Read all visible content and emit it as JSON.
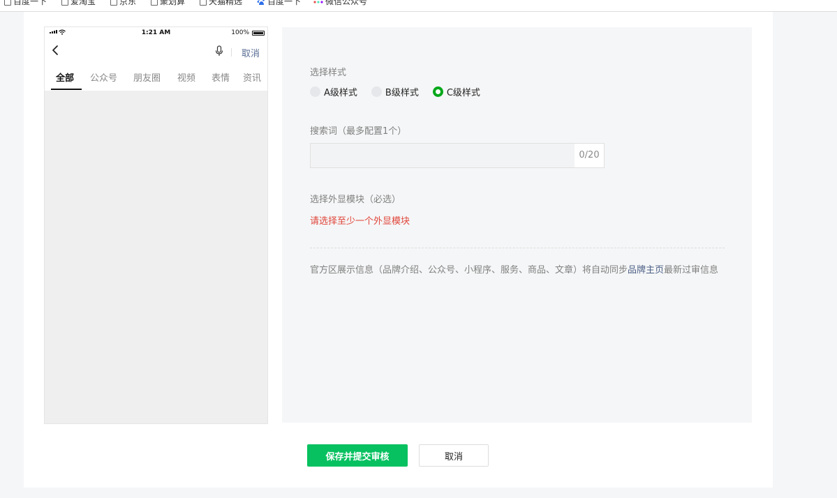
{
  "bookmarks": {
    "items": [
      {
        "label": "百度一下",
        "icon": "page-icon"
      },
      {
        "label": "爱淘宝",
        "icon": "page-icon"
      },
      {
        "label": "京东",
        "icon": "page-icon"
      },
      {
        "label": "聚划算",
        "icon": "page-icon"
      },
      {
        "label": "天猫精选",
        "icon": "page-icon"
      },
      {
        "label": "百度一下",
        "icon": "baidu-paw-icon"
      },
      {
        "label": "微信公众号",
        "icon": "wechat-mp-icon"
      }
    ]
  },
  "preview": {
    "status": {
      "time": "1:21 AM",
      "battery": "100%"
    },
    "cancel": "取消",
    "tabs": [
      "全部",
      "公众号",
      "朋友圈",
      "视频",
      "表情",
      "资讯"
    ],
    "active_tab": "全部"
  },
  "form": {
    "style_label": "选择样式",
    "style_options": [
      "A级样式",
      "B级样式",
      "C级样式"
    ],
    "selected_style": "C级样式",
    "keyword_label": "搜索词（最多配置1个）",
    "keyword_value": "",
    "keyword_counter": "0/20",
    "module_label": "选择外显模块（必选）",
    "module_error": "请选择至少一个外显模块",
    "note_before": "官方区展示信息（品牌介绍、公众号、小程序、服务、商品、文章）将自动同步",
    "note_link": "品牌主页",
    "note_after": "最新过审信息"
  },
  "actions": {
    "submit": "保存并提交审核",
    "cancel": "取消"
  },
  "colors": {
    "accent": "#07c160",
    "radio_selected": "#07a81b",
    "error": "#e0453a",
    "link": "#4a5f86"
  }
}
